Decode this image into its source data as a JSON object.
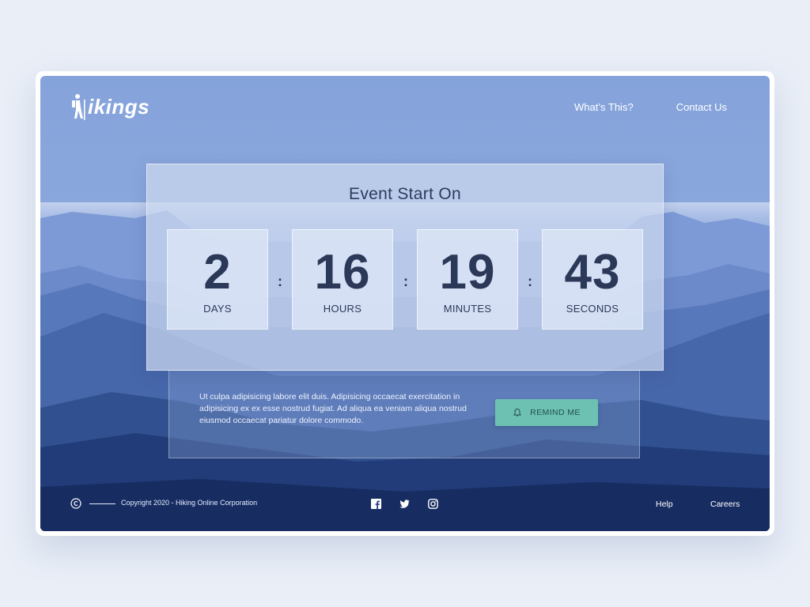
{
  "brand": {
    "name": "ikings"
  },
  "nav": {
    "whats_this": "What’s This?",
    "contact_us": "Contact Us"
  },
  "event": {
    "title": "Event Start On",
    "countdown": [
      {
        "value": "2",
        "unit": "DAYS"
      },
      {
        "value": "16",
        "unit": "HOURS"
      },
      {
        "value": "19",
        "unit": "MINUTES"
      },
      {
        "value": "43",
        "unit": "SECONDS"
      }
    ],
    "separator": ":"
  },
  "info": {
    "text": "Ut culpa adipisicing labore elit duis. Adipisicing occaecat exercitation in adipisicing ex ex esse nostrud fugiat. Ad aliqua ea veniam aliqua nostrud eiusmod occaecat pariatur dolore commodo.",
    "button_label": "REMIND ME"
  },
  "footer": {
    "copyright": "Copyright 2020 - Hiking Online Corporation",
    "links": {
      "help": "Help",
      "careers": "Careers"
    },
    "social_icons": [
      "facebook-icon",
      "twitter-icon",
      "instagram-icon"
    ]
  },
  "colors": {
    "accent": "#6cc1b2",
    "text_dark": "#2b3858",
    "page_bg": "#e9eef7"
  }
}
